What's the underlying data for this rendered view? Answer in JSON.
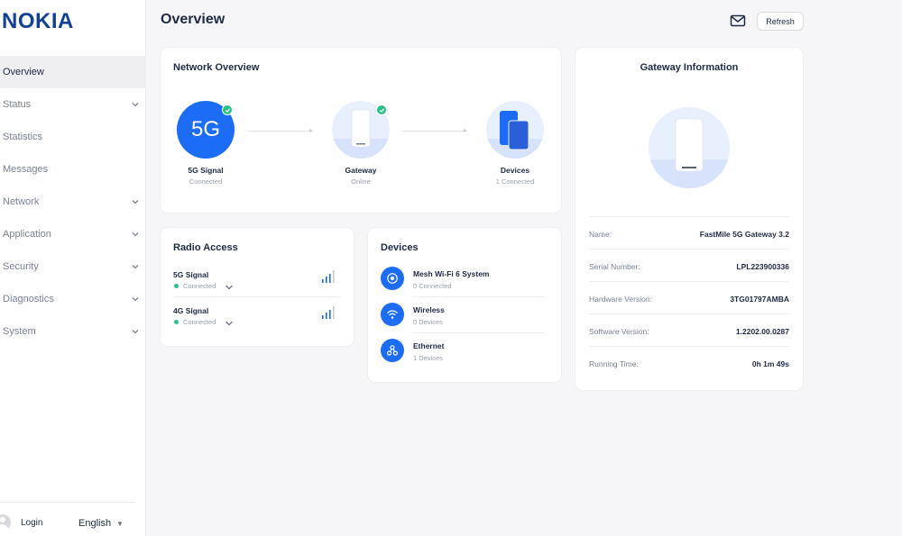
{
  "brand": {
    "logo": "NOKIA",
    "color": "#124191",
    "accent": "#1d6cf5",
    "ok": "#29c08a"
  },
  "sidebar": {
    "items": [
      {
        "label": "Overview",
        "active": true,
        "expandable": false
      },
      {
        "label": "Status",
        "active": false,
        "expandable": true
      },
      {
        "label": "Statistics",
        "active": false,
        "expandable": false
      },
      {
        "label": "Messages",
        "active": false,
        "expandable": false
      },
      {
        "label": "Network",
        "active": false,
        "expandable": true
      },
      {
        "label": "Application",
        "active": false,
        "expandable": true
      },
      {
        "label": "Security",
        "active": false,
        "expandable": true
      },
      {
        "label": "Diagnostics",
        "active": false,
        "expandable": true
      },
      {
        "label": "System",
        "active": false,
        "expandable": true
      }
    ],
    "login_label": "Login",
    "language": "English"
  },
  "header": {
    "title": "Overview",
    "mail_icon": "mail-icon",
    "refresh_label": "Refresh"
  },
  "network_overview": {
    "title": "Network Overview",
    "nodes": [
      {
        "icon_text": "5G",
        "label": "5G Signal",
        "status": "Connected",
        "checked": true
      },
      {
        "label": "Gateway",
        "status": "Online",
        "checked": true
      },
      {
        "label": "Devices",
        "status": "1 Connected",
        "checked": false
      }
    ]
  },
  "radio_access": {
    "title": "Radio Access",
    "signals": [
      {
        "name": "5G Signal",
        "status": "Connected"
      },
      {
        "name": "4G Signal",
        "status": "Connected"
      }
    ]
  },
  "devices": {
    "title": "Devices",
    "items": [
      {
        "name": "Mesh Wi-Fi 6 System",
        "count": "0 Connected",
        "icon": "mesh-icon"
      },
      {
        "name": "Wireless",
        "count": "0 Devices",
        "icon": "wifi-icon"
      },
      {
        "name": "Ethernet",
        "count": "1 Devices",
        "icon": "ethernet-icon"
      }
    ]
  },
  "gateway_info": {
    "title": "Gateway Information",
    "rows": [
      {
        "label": "Name:",
        "value": "FastMile 5G Gateway 3.2"
      },
      {
        "label": "Serial Number:",
        "value": "LPL223900336"
      },
      {
        "label": "Hardware Version:",
        "value": "3TG01797AMBA"
      },
      {
        "label": "Software Version:",
        "value": "1.2202.00.0287"
      },
      {
        "label": "Running Time:",
        "value": "0h 1m 49s"
      }
    ]
  }
}
